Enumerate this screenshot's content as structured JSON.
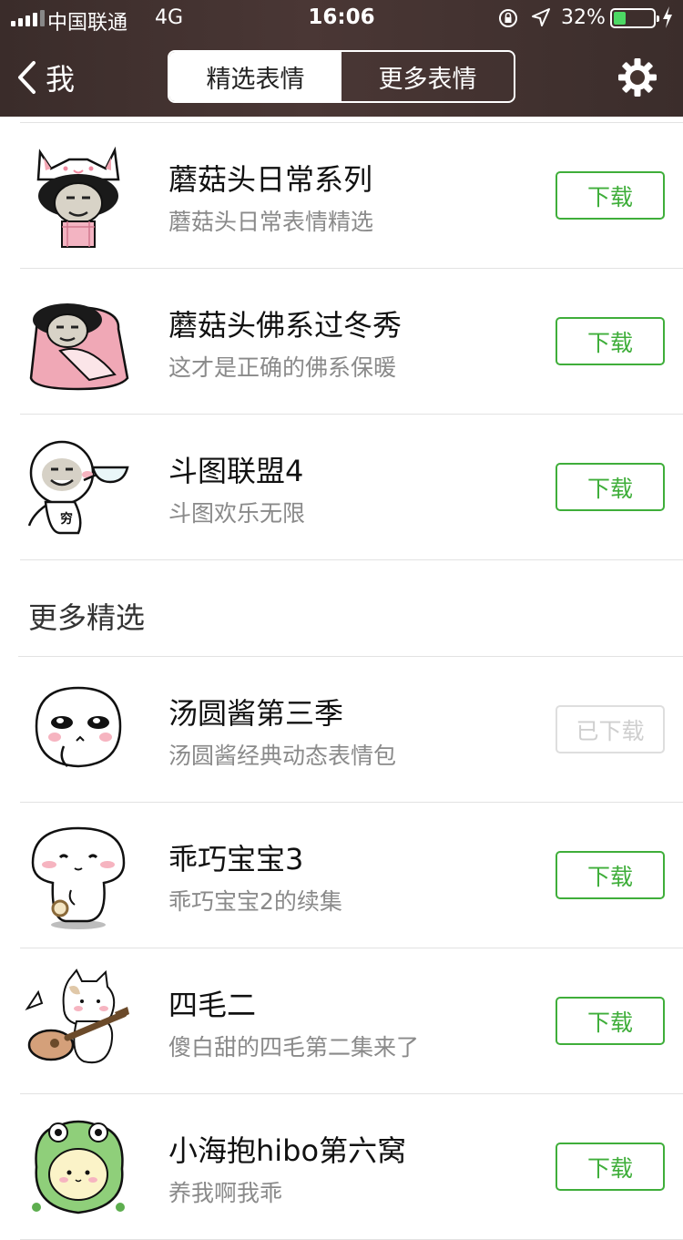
{
  "status_bar": {
    "carrier": "中国联通",
    "network": "4G",
    "time": "16:06",
    "battery_percent": "32%",
    "battery_level": 0.32
  },
  "nav": {
    "back_label": "我",
    "tabs": [
      {
        "label": "精选表情",
        "active": true
      },
      {
        "label": "更多表情",
        "active": false
      }
    ]
  },
  "featured": [
    {
      "title": "蘑菇头日常系列",
      "subtitle": "蘑菇头日常表情精选",
      "button": "下载",
      "downloaded": false
    },
    {
      "title": "蘑菇头佛系过冬秀",
      "subtitle": "这才是正确的佛系保暖",
      "button": "下载",
      "downloaded": false
    },
    {
      "title": "斗图联盟4",
      "subtitle": "斗图欢乐无限",
      "button": "下载",
      "downloaded": false
    }
  ],
  "section_title": "更多精选",
  "more": [
    {
      "title": "汤圆酱第三季",
      "subtitle": "汤圆酱经典动态表情包",
      "button": "已下载",
      "downloaded": true
    },
    {
      "title": "乖巧宝宝3",
      "subtitle": "乖巧宝宝2的续集",
      "button": "下载",
      "downloaded": false
    },
    {
      "title": "四毛二",
      "subtitle": "傻白甜的四毛第二集来了",
      "button": "下载",
      "downloaded": false
    },
    {
      "title": "小海抱hibo第六窝",
      "subtitle": "养我啊我乖",
      "button": "下载",
      "downloaded": false
    }
  ],
  "thumb_badge": "穷",
  "colors": {
    "accent_green": "#3fae3a",
    "nav_bg": "#4a3735",
    "disabled": "#cfcfcf"
  }
}
